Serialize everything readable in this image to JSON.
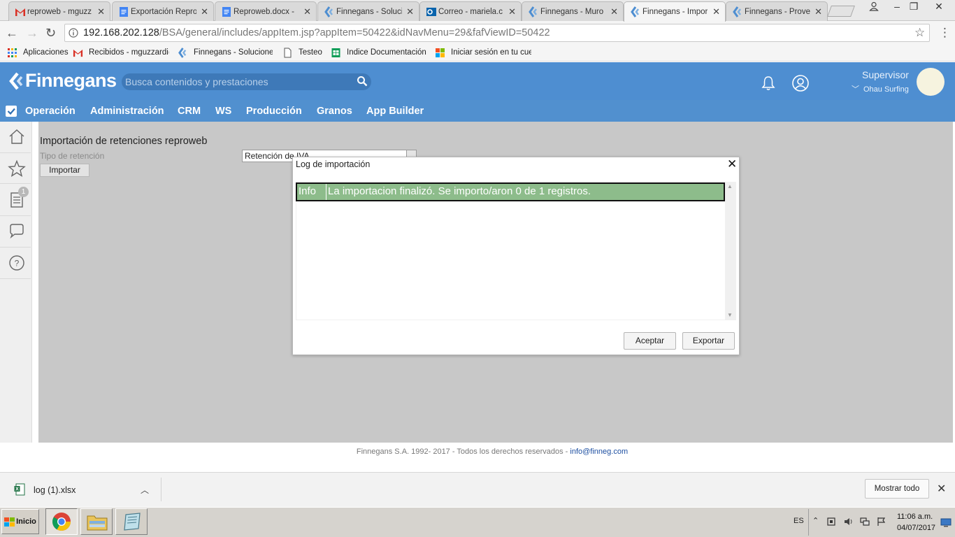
{
  "browser": {
    "tabs": [
      {
        "label": "reproweb - mguzz",
        "icon": "gmail-icon"
      },
      {
        "label": "Exportación Repro",
        "icon": "docs-icon"
      },
      {
        "label": "Reproweb.docx -",
        "icon": "docs-icon"
      },
      {
        "label": "Finnegans - Soluci",
        "icon": "finnegans-icon"
      },
      {
        "label": "Correo - mariela.c",
        "icon": "outlook-icon"
      },
      {
        "label": "Finnegans - Muro",
        "icon": "finnegans-icon"
      },
      {
        "label": "Finnegans - Impor",
        "icon": "finnegans-icon",
        "active": true
      },
      {
        "label": "Finnegans - Prove",
        "icon": "finnegans-icon"
      }
    ],
    "url_host": "192.168.202.128",
    "url_path": "/BSA/general/includes/appItem.jsp?appItem=50422&idNavMenu=29&fafViewID=50422",
    "bookmarks": [
      {
        "label": "Aplicaciones",
        "icon": "apps-grid-icon"
      },
      {
        "label": "Recibidos - mguzzardi@",
        "icon": "gmail-icon"
      },
      {
        "label": "Finnegans - Soluciones",
        "icon": "finnegans-icon"
      },
      {
        "label": "Testeo",
        "icon": "page-icon"
      },
      {
        "label": "Indice Documentación S",
        "icon": "sheets-icon"
      },
      {
        "label": "Iniciar sesión en tu cuen",
        "icon": "microsoft-icon"
      }
    ]
  },
  "app": {
    "logo": "Finnegans",
    "search_placeholder": "Busca contenidos y prestaciones",
    "user_name": "Supervisor",
    "company": "Ohau Surfing",
    "nav": [
      "Operación",
      "Administración",
      "CRM",
      "WS",
      "Producción",
      "Granos",
      "App Builder"
    ],
    "sidebar_badge": "1",
    "colors": {
      "header": "#4e8ed1",
      "nav": "#5190cf",
      "log_row": "#8dbc8b"
    }
  },
  "page": {
    "title": "Importación de retenciones reproweb",
    "tipo_label": "Tipo de retención",
    "tipo_value": "Retención de IVA",
    "importar_label": "Importar"
  },
  "modal": {
    "title": "Log de importación",
    "close": "✕",
    "log": [
      {
        "type": "Info",
        "message": "La importacion finalizó. Se importo/aron 0 de 1 registros."
      }
    ],
    "accept_label": "Aceptar",
    "export_label": "Exportar"
  },
  "footer": {
    "text": "Finnegans S.A. 1992- 2017 - Todos los derechos reservados - ",
    "link": "info@finneg.com"
  },
  "downloads": {
    "file": "log (1).xlsx",
    "show_all": "Mostrar todo"
  },
  "taskbar": {
    "start": "Inicio",
    "lang": "ES",
    "time": "11:06 a.m.",
    "date": "04/07/2017"
  }
}
